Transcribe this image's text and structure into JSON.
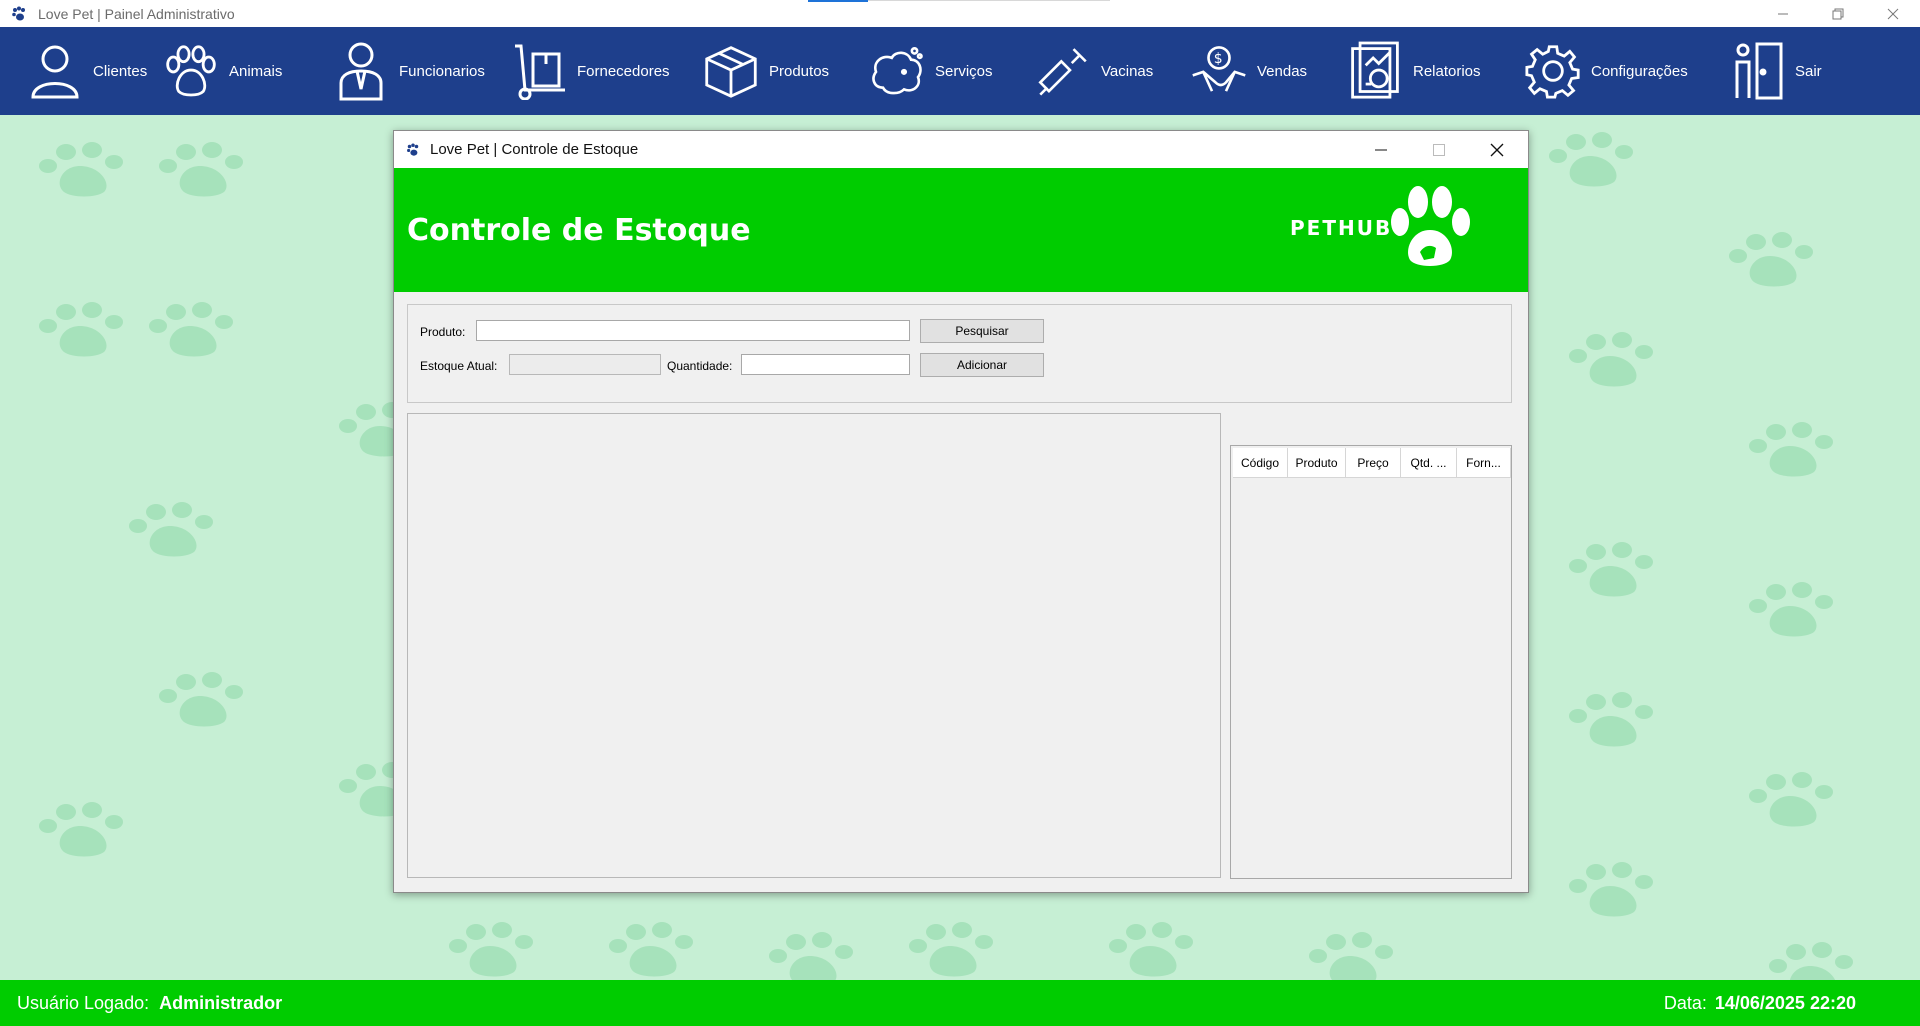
{
  "app": {
    "title": "Love Pet | Painel Administrativo"
  },
  "nav": {
    "items": [
      {
        "label": "Clientes",
        "icon": "person-icon"
      },
      {
        "label": "Animais",
        "icon": "paw-icon"
      },
      {
        "label": "Funcionarios",
        "icon": "employee-icon"
      },
      {
        "label": "Fornecedores",
        "icon": "hand-truck-icon"
      },
      {
        "label": "Produtos",
        "icon": "box-icon"
      },
      {
        "label": "Serviços",
        "icon": "dog-bath-icon"
      },
      {
        "label": "Vacinas",
        "icon": "syringe-icon"
      },
      {
        "label": "Vendas",
        "icon": "handshake-money-icon"
      },
      {
        "label": "Relatorios",
        "icon": "report-icon"
      },
      {
        "label": "Configurações",
        "icon": "gear-icon"
      },
      {
        "label": "Sair",
        "icon": "exit-door-icon"
      }
    ]
  },
  "dialog": {
    "title": "Love Pet | Controle de Estoque",
    "header_title": "Controle de Estoque",
    "brand": "PETHUB",
    "form": {
      "produto_label": "Produto:",
      "produto_value": "",
      "estoque_label": "Estoque Atual:",
      "estoque_value": "",
      "quantidade_label": "Quantidade:",
      "quantidade_value": "",
      "pesquisar_label": "Pesquisar",
      "adicionar_label": "Adicionar"
    },
    "table": {
      "columns": [
        "Código",
        "Produto",
        "Preço",
        "Qtd. ...",
        "Forn..."
      ],
      "rows": []
    }
  },
  "status": {
    "user_label": "Usuário Logado:",
    "user_value": "Administrador",
    "date_label": "Data:",
    "date_value": "14/06/2025 22:20"
  },
  "colors": {
    "nav_bg": "#1e3f8c",
    "green": "#00cc00",
    "background": "#c6efd4"
  }
}
